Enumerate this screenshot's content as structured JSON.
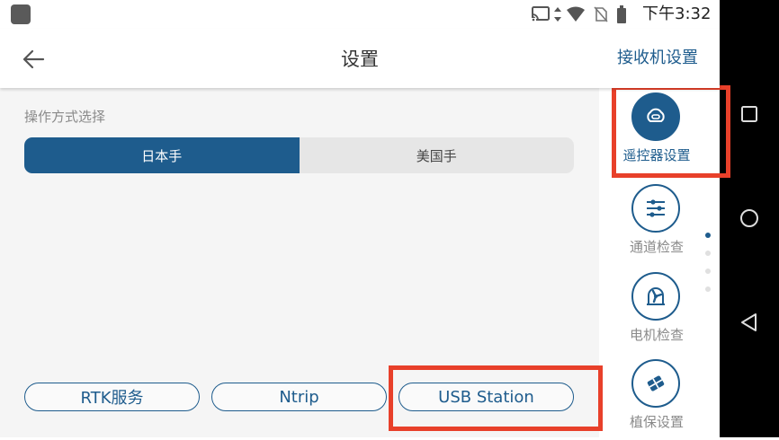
{
  "status_bar": {
    "time": "下午3:32",
    "icons": [
      "app-icon",
      "cast-icon",
      "data-arrows-icon",
      "wifi-icon",
      "no-sim-icon",
      "battery-icon"
    ]
  },
  "header": {
    "back_icon": "arrow-left-icon",
    "title": "设置",
    "right_link": "接收机设置"
  },
  "main": {
    "section_label": "操作方式选择",
    "mode_options": [
      {
        "label": "日本手",
        "selected": true
      },
      {
        "label": "美国手",
        "selected": false
      }
    ],
    "buttons": [
      {
        "label": "RTK服务"
      },
      {
        "label": "Ntrip"
      },
      {
        "label": "USB Station"
      }
    ]
  },
  "sidebar": {
    "items": [
      {
        "label": "遥控器设置",
        "icon": "remote-controller-icon",
        "active": true
      },
      {
        "label": "通道检查",
        "icon": "sliders-icon",
        "active": false
      },
      {
        "label": "电机检查",
        "icon": "motor-icon",
        "active": false
      },
      {
        "label": "植保设置",
        "icon": "spray-grid-icon",
        "active": false
      }
    ],
    "page_indicator": {
      "count": 4,
      "active": 1
    }
  },
  "nav_bar": {
    "buttons": [
      "recents-square-icon",
      "home-circle-icon",
      "back-triangle-icon"
    ]
  },
  "colors": {
    "accent": "#1e5c8d",
    "highlight": "#e8402a",
    "main_bg": "#f5f5f5",
    "segment_inactive_bg": "#e6e6e6",
    "nav_bar_bg": "#000000"
  }
}
